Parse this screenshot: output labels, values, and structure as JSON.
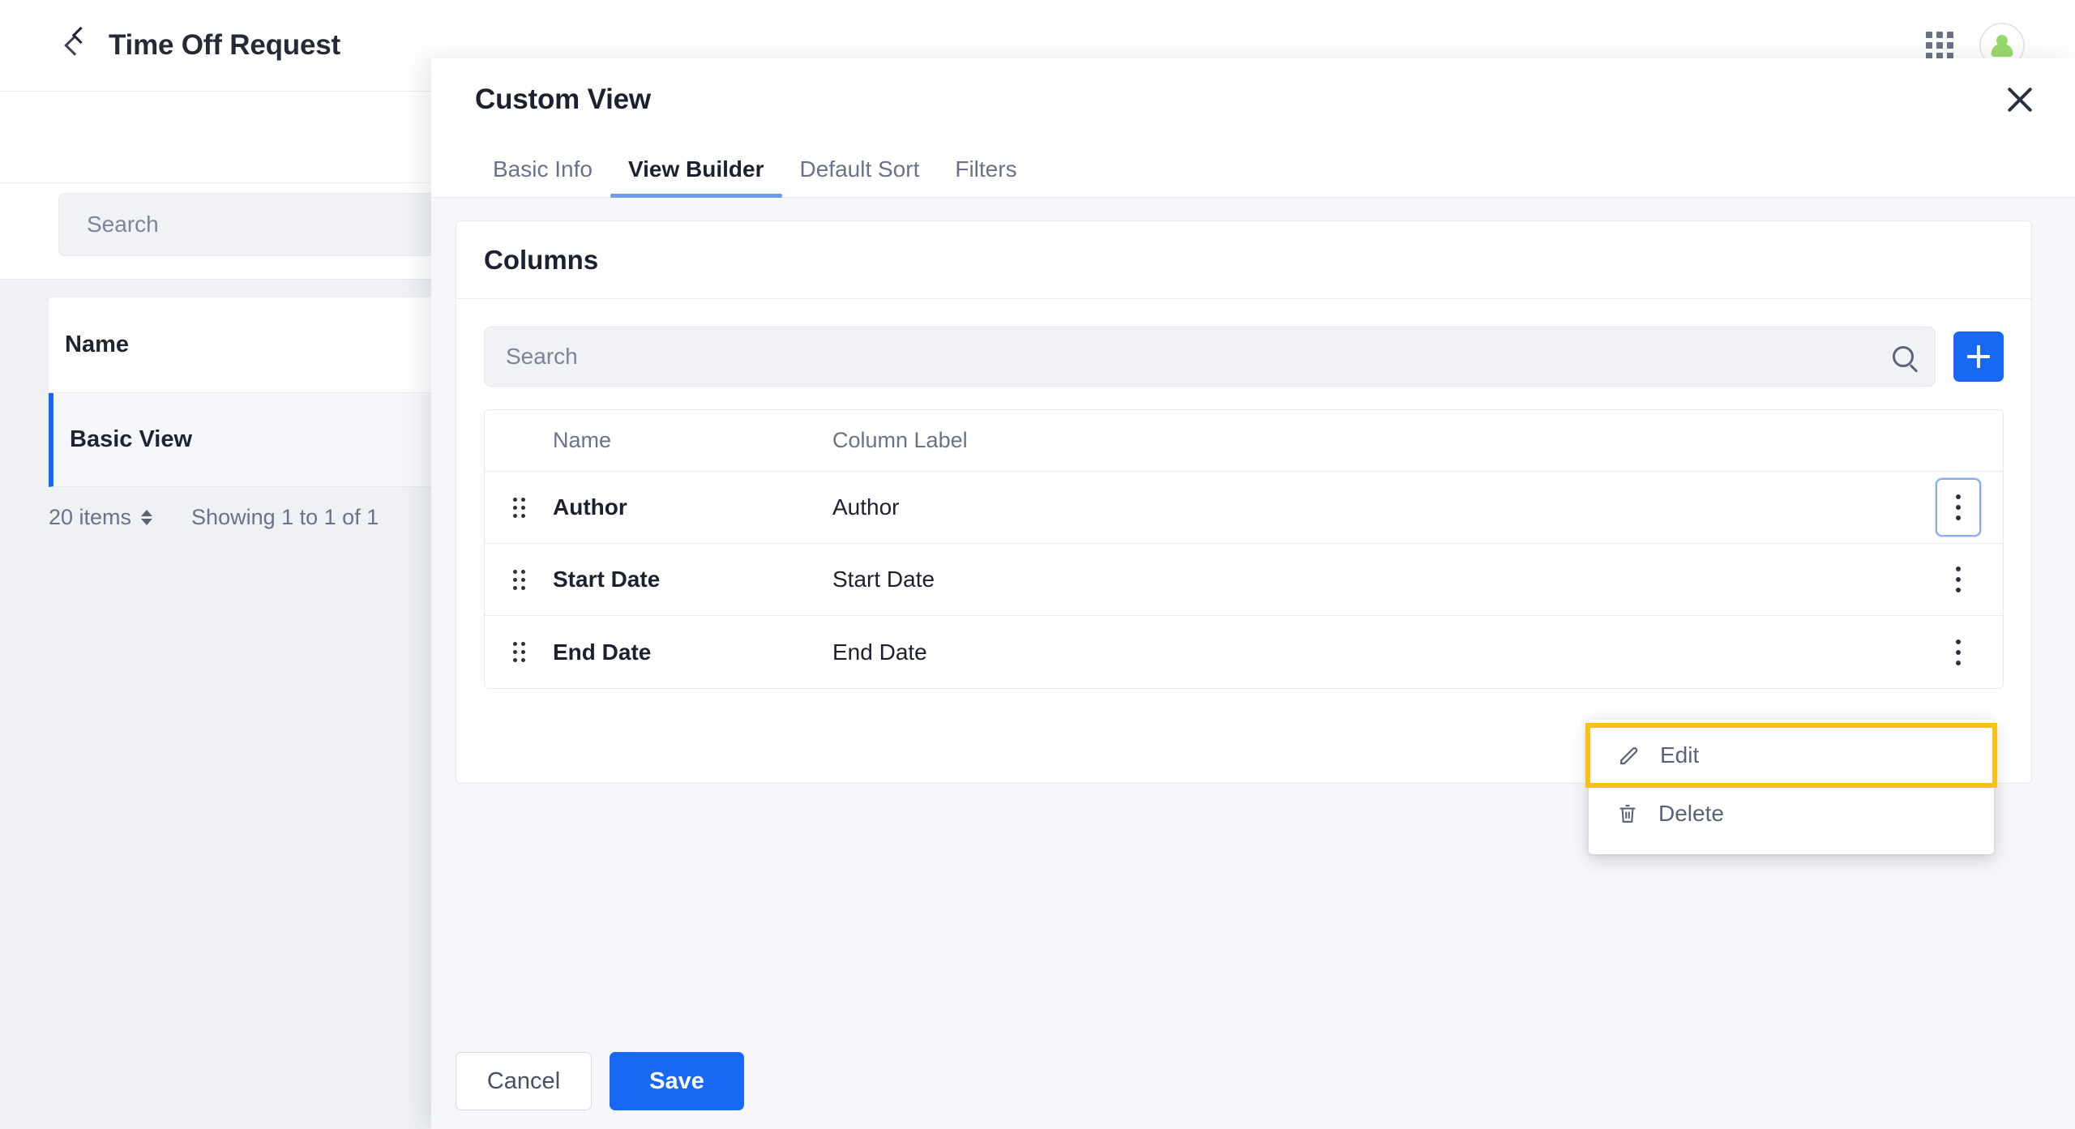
{
  "appbar": {
    "title": "Time Off Request",
    "back_icon": "chevron-left-icon",
    "apps_icon": "grid-apps-icon",
    "avatar_icon": "user-avatar-icon"
  },
  "subbar": {
    "back_icon": "chevron-left-icon"
  },
  "search": {
    "placeholder": "Search",
    "value": ""
  },
  "list": {
    "header": "Name",
    "rows": [
      {
        "label": "Basic View",
        "selected": true
      }
    ],
    "footer": {
      "items_per_page": "20 items",
      "showing": "Showing 1 to 1 of 1"
    }
  },
  "modal": {
    "title": "Custom View",
    "close_icon": "close-icon",
    "tabs": [
      {
        "label": "Basic Info",
        "active": false
      },
      {
        "label": "View Builder",
        "active": true
      },
      {
        "label": "Default Sort",
        "active": false
      },
      {
        "label": "Filters",
        "active": false
      }
    ],
    "panel": {
      "title": "Columns",
      "search": {
        "placeholder": "Search",
        "value": "",
        "icon": "search-icon"
      },
      "add_button_icon": "plus-icon",
      "table": {
        "columns": [
          "Name",
          "Column Label"
        ],
        "rows": [
          {
            "name": "Author",
            "label": "Author",
            "handle_icon": "drag-handle-icon",
            "menu_icon": "kebab-menu-icon",
            "menu_open": true
          },
          {
            "name": "Start Date",
            "label": "Start Date",
            "handle_icon": "drag-handle-icon",
            "menu_icon": "kebab-menu-icon",
            "menu_open": false
          },
          {
            "name": "End Date",
            "label": "End Date",
            "handle_icon": "drag-handle-icon",
            "menu_icon": "kebab-menu-icon",
            "menu_open": false
          }
        ]
      },
      "row_menu": {
        "items": [
          {
            "label": "Edit",
            "icon": "pencil-icon",
            "highlighted": true
          },
          {
            "label": "Delete",
            "icon": "trash-icon",
            "highlighted": false
          }
        ]
      }
    },
    "footer": {
      "cancel_label": "Cancel",
      "save_label": "Save"
    }
  },
  "colors": {
    "accent_blue": "#1769f5",
    "tab_underline": "#6e9bf2",
    "highlight_yellow": "#f9c115",
    "avatar_green": "#98da6c",
    "page_bg": "#eff1f5"
  }
}
